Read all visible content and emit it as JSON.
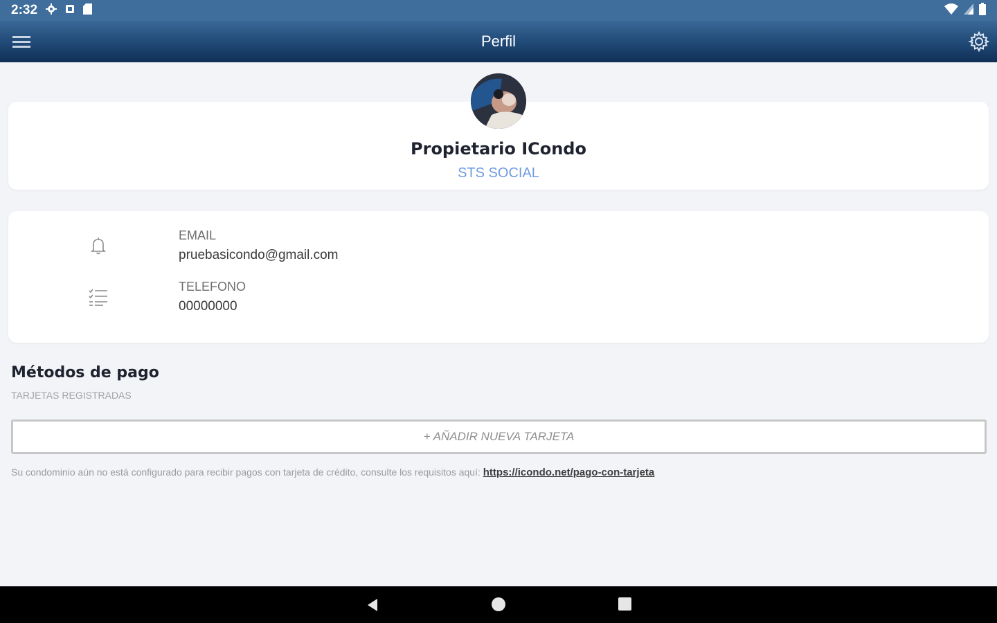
{
  "status_bar": {
    "time": "2:32"
  },
  "app_bar": {
    "title": "Perfil"
  },
  "profile": {
    "name": "Propietario ICondo",
    "subtitle": "STS SOCIAL"
  },
  "contact": {
    "email_label": "EMAIL",
    "email_value": "pruebasicondo@gmail.com",
    "phone_label": "TELEFONO",
    "phone_value": "00000000"
  },
  "payment": {
    "title": "Métodos de pago",
    "subtitle": "TARJETAS REGISTRADAS",
    "add_button_label": "+ AÑADIR NUEVA TARJETA",
    "notice_text": "Su condominio aún no está configurado para recibir pagos con tarjeta de crédito, consulte los requisitos aquí: ",
    "notice_link": "https://icondo.net/pago-con-tarjeta"
  },
  "colors": {
    "status_bar": "#3f6d9c",
    "app_bar_top": "#3a6897",
    "app_bar_bottom": "#0f2f57",
    "accent_subtitle": "#6f9ce0",
    "page_background": "#f2f4f8"
  },
  "icons": {
    "status": [
      "settings-icon",
      "notification-icon",
      "sd-card-icon",
      "wifi-icon",
      "signal-icon",
      "battery-icon"
    ],
    "app_bar": [
      "menu-icon",
      "gear-icon"
    ],
    "contact": [
      "bell-icon",
      "checklist-icon"
    ],
    "navigation": [
      "back-icon",
      "home-icon",
      "recents-icon"
    ]
  }
}
